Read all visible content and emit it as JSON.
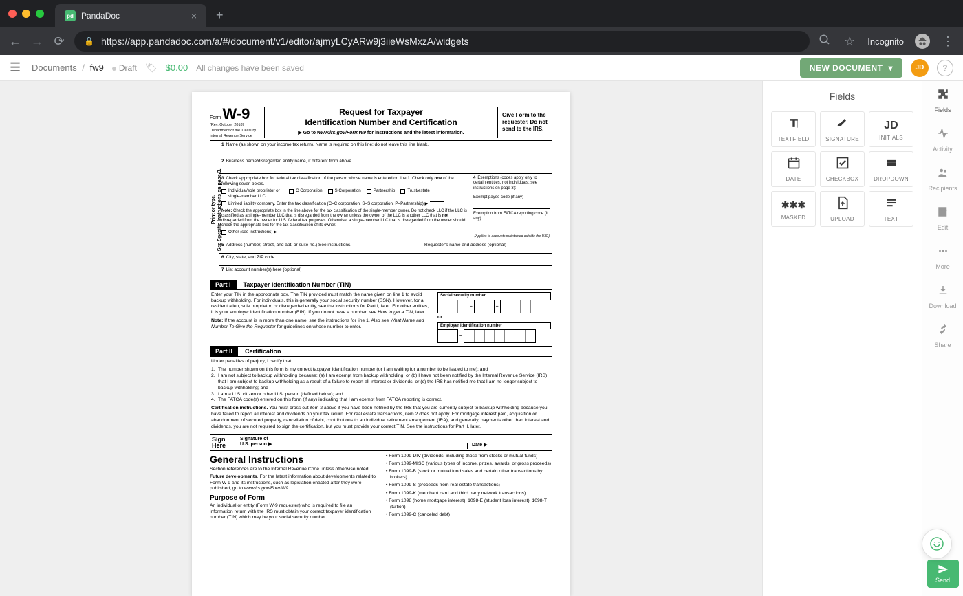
{
  "browser": {
    "tab_title": "PandaDoc",
    "tab_favicon": "pd",
    "url": "https://app.pandadoc.com/a/#/document/v1/editor/ajmyLCyARw9j3iieWsMxzA/widgets",
    "incognito": "Incognito"
  },
  "header": {
    "breadcrumb_root": "Documents",
    "doc_name": "fw9",
    "status": "Draft",
    "price": "$0.00",
    "save_status": "All changes have been saved",
    "new_doc_label": "NEW DOCUMENT",
    "avatar_initials": "JD"
  },
  "fields_panel": {
    "title": "Fields",
    "items": [
      {
        "label": "TEXTFIELD",
        "icon": "textfield"
      },
      {
        "label": "SIGNATURE",
        "icon": "signature"
      },
      {
        "label": "INITIALS",
        "icon": "initials"
      },
      {
        "label": "DATE",
        "icon": "date"
      },
      {
        "label": "CHECKBOX",
        "icon": "checkbox"
      },
      {
        "label": "DROPDOWN",
        "icon": "dropdown"
      },
      {
        "label": "MASKED",
        "icon": "masked"
      },
      {
        "label": "UPLOAD",
        "icon": "upload"
      },
      {
        "label": "TEXT",
        "icon": "text"
      }
    ]
  },
  "rail": {
    "items": [
      {
        "label": "Fields",
        "icon": "puzzle"
      },
      {
        "label": "Activity",
        "icon": "activity"
      },
      {
        "label": "Recipients",
        "icon": "people"
      },
      {
        "label": "Edit",
        "icon": "edit"
      },
      {
        "label": "More",
        "icon": "more"
      },
      {
        "label": "Download",
        "icon": "download"
      },
      {
        "label": "Share",
        "icon": "share"
      }
    ],
    "send_label": "Send"
  },
  "w9": {
    "form_word": "Form",
    "form_code": "W-9",
    "rev": "(Rev. October 2018)",
    "dept1": "Department of the Treasury",
    "dept2": "Internal Revenue Service",
    "title1": "Request for Taxpayer",
    "title2": "Identification Number and Certification",
    "instr_prefix": "▶ Go to",
    "instr_url": "www.irs.gov/FormW9",
    "instr_suffix": "for instructions and the latest information.",
    "header_right": "Give Form to the requester. Do not send to the IRS.",
    "vertical": "Print or type.\nSee Specific Instructions on page 3.",
    "line1": "Name (as shown on your income tax return). Name is required on this line; do not leave this line blank.",
    "line2": "Business name/disregarded entity name, if different from above",
    "line3_intro": "Check appropriate box for federal tax classification of the person whose name is entered on line 1. Check only",
    "line3_one": "one",
    "line3_tail": "of the following seven boxes.",
    "chk_ind": "Individual/sole proprietor or single-member LLC",
    "chk_ccorp": "C Corporation",
    "chk_scorp": "S Corporation",
    "chk_partnership": "Partnership",
    "chk_trust": "Trust/estate",
    "chk_llc": "Limited liability company. Enter the tax classification (C=C corporation, S=S corporation, P=Partnership) ▶",
    "llc_note_label": "Note:",
    "llc_note": "Check the appropriate box in the line above for the tax classification of the single-member owner. Do not check LLC if the LLC is classified as a single-member LLC that is disregarded from the owner unless the owner of the LLC is another LLC that is",
    "llc_note_not": "not",
    "llc_note2": "disregarded from the owner for U.S. federal tax purposes. Otherwise, a single-member LLC that is disregarded from the owner should check the appropriate box for the tax classification of its owner.",
    "chk_other": "Other (see instructions) ▶",
    "exempt_head": "Exemptions (codes apply only to certain entities, not individuals; see instructions on page 3):",
    "exempt_payee": "Exempt payee code (if any)",
    "exempt_fatca": "Exemption from FATCA reporting code (if any)",
    "exempt_small": "(Applies to accounts maintained outside the U.S.)",
    "line5": "Address (number, street, and apt. or suite no.) See instructions.",
    "line5b": "Requester's name and address (optional)",
    "line6": "City, state, and ZIP code",
    "line7": "List account number(s) here (optional)",
    "part1_label": "Part I",
    "part1_title": "Taxpayer Identification Number (TIN)",
    "part1_body": "Enter your TIN in the appropriate box. The TIN provided must match the name given on line 1 to avoid backup withholding. For individuals, this is generally your social security number (SSN). However, for a resident alien, sole proprietor, or disregarded entity, see the instructions for Part I, later. For other entities, it is your employer identification number (EIN). If you do not have a number, see",
    "part1_howto": "How to get a TIN",
    "part1_later": ", later.",
    "part1_note_label": "Note:",
    "part1_note": "If the account is in more than one name, see the instructions for line 1. Also see",
    "part1_note_em": "What Name and Number To Give the Requester",
    "part1_note_tail": "for guidelines on whose number to enter.",
    "ssn_label": "Social security number",
    "or": "or",
    "ein_label": "Employer identification number",
    "part2_label": "Part II",
    "part2_title": "Certification",
    "cert_preamble": "Under penalties of perjury, I certify that:",
    "cert1": "The number shown on this form is my correct taxpayer identification number (or I am waiting for a number to be issued to me); and",
    "cert2": "I am not subject to backup withholding because: (a) I am exempt from backup withholding, or (b) I have not been notified by the Internal Revenue Service (IRS) that I am subject to backup withholding as a result of a failure to report all interest or dividends, or (c) the IRS has notified me that I am no longer subject to backup withholding; and",
    "cert3": "I am a U.S. citizen or other U.S. person (defined below); and",
    "cert4": "The FATCA code(s) entered on this form (if any) indicating that I am exempt from FATCA reporting is correct.",
    "cert_instr_label": "Certification instructions.",
    "cert_instr": "You must cross out item 2 above if you have been notified by the IRS that you are currently subject to backup withholding because you have failed to report all interest and dividends on your tax return. For real estate transactions, item 2 does not apply. For mortgage interest paid, acquisition or abandonment of secured property, cancellation of debt, contributions to an individual retirement arrangement (IRA), and generally, payments other than interest and dividends, you are not required to sign the certification, but you must provide your correct TIN. See the instructions for Part II, later.",
    "sign_here": "Sign Here",
    "sig_of": "Signature of",
    "us_person": "U.S. person ▶",
    "date_label": "Date ▶",
    "gi_title": "General Instructions",
    "gi_p1": "Section references are to the Internal Revenue Code unless otherwise noted.",
    "gi_future_label": "Future developments",
    "gi_future": ". For the latest information about developments related to Form W-9 and its instructions, such as legislation enacted after they were published, go to",
    "gi_future_url": "www.irs.gov/FormW9",
    "gi_purpose": "Purpose of Form",
    "gi_p2": "An individual or entity (Form W-9 requester) who is required to file an information return with the IRS must obtain your correct taxpayer identification number (TIN) which may be your social security number",
    "gi_b1": "• Form 1099-DIV (dividends, including those from stocks or mutual funds)",
    "gi_b2": "• Form 1099-MISC (various types of income, prizes, awards, or gross proceeds)",
    "gi_b3": "• Form 1099-B (stock or mutual fund sales and certain other transactions by brokers)",
    "gi_b4": "• Form 1099-S (proceeds from real estate transactions)",
    "gi_b5": "• Form 1099-K (merchant card and third party network transactions)",
    "gi_b6": "• Form 1098 (home mortgage interest), 1098-E (student loan interest), 1098-T (tuition)",
    "gi_b7": "• Form 1099-C (canceled debt)"
  },
  "field_icons": {
    "initials": "JD"
  }
}
